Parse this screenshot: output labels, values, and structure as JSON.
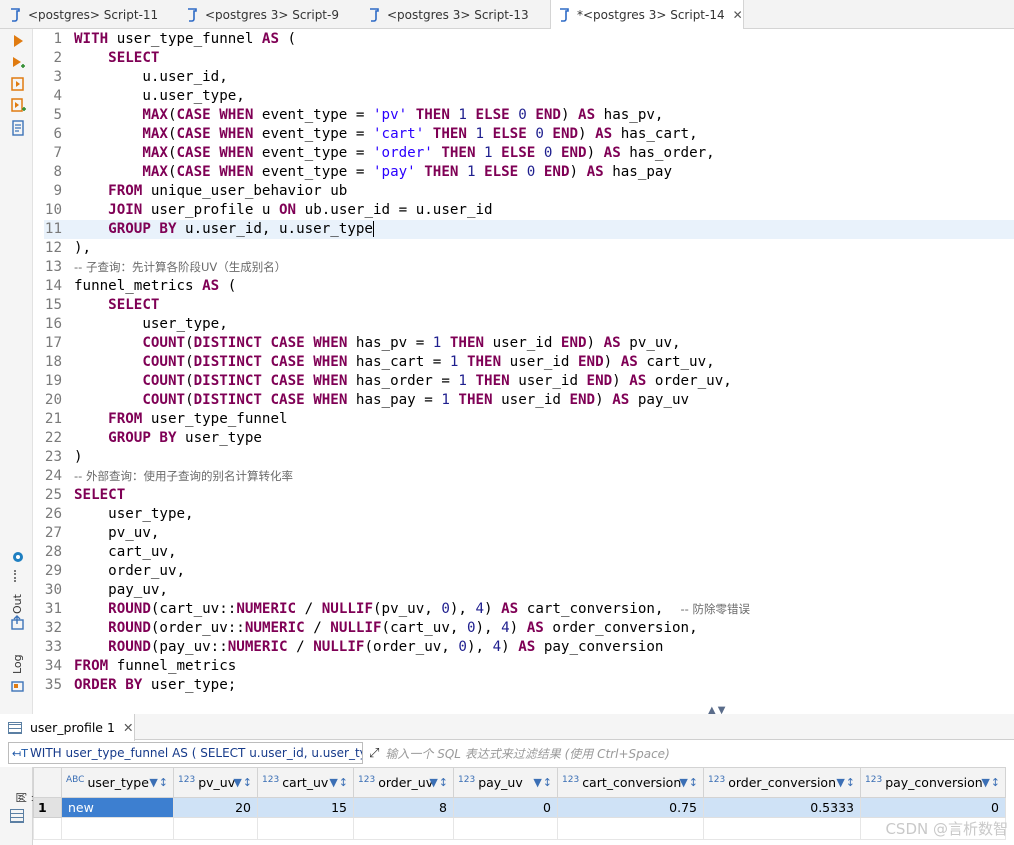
{
  "tabs": [
    {
      "label": "<postgres> Script-11",
      "active": false
    },
    {
      "label": "<postgres 3> Script-9",
      "active": false
    },
    {
      "label": "<postgres 3> Script-13",
      "active": false
    },
    {
      "label": "*<postgres 3> Script-14",
      "active": true
    }
  ],
  "left_toolbar": {
    "out_label": "Out",
    "log_label": "Log"
  },
  "editor": {
    "current_line": 11,
    "lines": [
      {
        "n": 1,
        "tokens": [
          [
            "kw",
            "WITH"
          ],
          [
            "t",
            " user_type_funnel "
          ],
          [
            "kw",
            "AS"
          ],
          [
            "t",
            " ("
          ]
        ]
      },
      {
        "n": 2,
        "tokens": [
          [
            "t",
            "    "
          ],
          [
            "kw",
            "SELECT"
          ]
        ]
      },
      {
        "n": 3,
        "tokens": [
          [
            "t",
            "        u.user_id,"
          ]
        ]
      },
      {
        "n": 4,
        "tokens": [
          [
            "t",
            "        u.user_type,"
          ]
        ]
      },
      {
        "n": 5,
        "tokens": [
          [
            "t",
            "        "
          ],
          [
            "kw",
            "MAX"
          ],
          [
            "t",
            "("
          ],
          [
            "kw",
            "CASE WHEN"
          ],
          [
            "t",
            " event_type = "
          ],
          [
            "str",
            "'pv'"
          ],
          [
            "t",
            " "
          ],
          [
            "kw",
            "THEN"
          ],
          [
            "t",
            " "
          ],
          [
            "num",
            "1"
          ],
          [
            "t",
            " "
          ],
          [
            "kw",
            "ELSE"
          ],
          [
            "t",
            " "
          ],
          [
            "num",
            "0"
          ],
          [
            "t",
            " "
          ],
          [
            "kw",
            "END"
          ],
          [
            "t",
            ") "
          ],
          [
            "kw",
            "AS"
          ],
          [
            "t",
            " has_pv,"
          ]
        ]
      },
      {
        "n": 6,
        "tokens": [
          [
            "t",
            "        "
          ],
          [
            "kw",
            "MAX"
          ],
          [
            "t",
            "("
          ],
          [
            "kw",
            "CASE WHEN"
          ],
          [
            "t",
            " event_type = "
          ],
          [
            "str",
            "'cart'"
          ],
          [
            "t",
            " "
          ],
          [
            "kw",
            "THEN"
          ],
          [
            "t",
            " "
          ],
          [
            "num",
            "1"
          ],
          [
            "t",
            " "
          ],
          [
            "kw",
            "ELSE"
          ],
          [
            "t",
            " "
          ],
          [
            "num",
            "0"
          ],
          [
            "t",
            " "
          ],
          [
            "kw",
            "END"
          ],
          [
            "t",
            ") "
          ],
          [
            "kw",
            "AS"
          ],
          [
            "t",
            " has_cart,"
          ]
        ]
      },
      {
        "n": 7,
        "tokens": [
          [
            "t",
            "        "
          ],
          [
            "kw",
            "MAX"
          ],
          [
            "t",
            "("
          ],
          [
            "kw",
            "CASE WHEN"
          ],
          [
            "t",
            " event_type = "
          ],
          [
            "str",
            "'order'"
          ],
          [
            "t",
            " "
          ],
          [
            "kw",
            "THEN"
          ],
          [
            "t",
            " "
          ],
          [
            "num",
            "1"
          ],
          [
            "t",
            " "
          ],
          [
            "kw",
            "ELSE"
          ],
          [
            "t",
            " "
          ],
          [
            "num",
            "0"
          ],
          [
            "t",
            " "
          ],
          [
            "kw",
            "END"
          ],
          [
            "t",
            ") "
          ],
          [
            "kw",
            "AS"
          ],
          [
            "t",
            " has_order,"
          ]
        ]
      },
      {
        "n": 8,
        "tokens": [
          [
            "t",
            "        "
          ],
          [
            "kw",
            "MAX"
          ],
          [
            "t",
            "("
          ],
          [
            "kw",
            "CASE WHEN"
          ],
          [
            "t",
            " event_type = "
          ],
          [
            "str",
            "'pay'"
          ],
          [
            "t",
            " "
          ],
          [
            "kw",
            "THEN"
          ],
          [
            "t",
            " "
          ],
          [
            "num",
            "1"
          ],
          [
            "t",
            " "
          ],
          [
            "kw",
            "ELSE"
          ],
          [
            "t",
            " "
          ],
          [
            "num",
            "0"
          ],
          [
            "t",
            " "
          ],
          [
            "kw",
            "END"
          ],
          [
            "t",
            ") "
          ],
          [
            "kw",
            "AS"
          ],
          [
            "t",
            " has_pay"
          ]
        ]
      },
      {
        "n": 9,
        "tokens": [
          [
            "t",
            "    "
          ],
          [
            "kw",
            "FROM"
          ],
          [
            "t",
            " unique_user_behavior ub"
          ]
        ]
      },
      {
        "n": 10,
        "tokens": [
          [
            "t",
            "    "
          ],
          [
            "kw",
            "JOIN"
          ],
          [
            "t",
            " user_profile u "
          ],
          [
            "kw",
            "ON"
          ],
          [
            "t",
            " ub.user_id = u.user_id"
          ]
        ]
      },
      {
        "n": 11,
        "tokens": [
          [
            "t",
            "    "
          ],
          [
            "kw",
            "GROUP BY"
          ],
          [
            "t",
            " u.user_id, u.user_type"
          ]
        ]
      },
      {
        "n": 12,
        "tokens": [
          [
            "t",
            "),"
          ]
        ]
      },
      {
        "n": 13,
        "tokens": [
          [
            "cm",
            "-- 子查询：先计算各阶段UV（生成别名）"
          ]
        ]
      },
      {
        "n": 14,
        "tokens": [
          [
            "t",
            "funnel_metrics "
          ],
          [
            "kw",
            "AS"
          ],
          [
            "t",
            " ("
          ]
        ]
      },
      {
        "n": 15,
        "tokens": [
          [
            "t",
            "    "
          ],
          [
            "kw",
            "SELECT"
          ]
        ]
      },
      {
        "n": 16,
        "tokens": [
          [
            "t",
            "        user_type,"
          ]
        ]
      },
      {
        "n": 17,
        "tokens": [
          [
            "t",
            "        "
          ],
          [
            "kw",
            "COUNT"
          ],
          [
            "t",
            "("
          ],
          [
            "kw",
            "DISTINCT CASE WHEN"
          ],
          [
            "t",
            " has_pv = "
          ],
          [
            "num",
            "1"
          ],
          [
            "t",
            " "
          ],
          [
            "kw",
            "THEN"
          ],
          [
            "t",
            " user_id "
          ],
          [
            "kw",
            "END"
          ],
          [
            "t",
            ") "
          ],
          [
            "kw",
            "AS"
          ],
          [
            "t",
            " pv_uv,"
          ]
        ]
      },
      {
        "n": 18,
        "tokens": [
          [
            "t",
            "        "
          ],
          [
            "kw",
            "COUNT"
          ],
          [
            "t",
            "("
          ],
          [
            "kw",
            "DISTINCT CASE WHEN"
          ],
          [
            "t",
            " has_cart = "
          ],
          [
            "num",
            "1"
          ],
          [
            "t",
            " "
          ],
          [
            "kw",
            "THEN"
          ],
          [
            "t",
            " user_id "
          ],
          [
            "kw",
            "END"
          ],
          [
            "t",
            ") "
          ],
          [
            "kw",
            "AS"
          ],
          [
            "t",
            " cart_uv,"
          ]
        ]
      },
      {
        "n": 19,
        "tokens": [
          [
            "t",
            "        "
          ],
          [
            "kw",
            "COUNT"
          ],
          [
            "t",
            "("
          ],
          [
            "kw",
            "DISTINCT CASE WHEN"
          ],
          [
            "t",
            " has_order = "
          ],
          [
            "num",
            "1"
          ],
          [
            "t",
            " "
          ],
          [
            "kw",
            "THEN"
          ],
          [
            "t",
            " user_id "
          ],
          [
            "kw",
            "END"
          ],
          [
            "t",
            ") "
          ],
          [
            "kw",
            "AS"
          ],
          [
            "t",
            " order_uv,"
          ]
        ]
      },
      {
        "n": 20,
        "tokens": [
          [
            "t",
            "        "
          ],
          [
            "kw",
            "COUNT"
          ],
          [
            "t",
            "("
          ],
          [
            "kw",
            "DISTINCT CASE WHEN"
          ],
          [
            "t",
            " has_pay = "
          ],
          [
            "num",
            "1"
          ],
          [
            "t",
            " "
          ],
          [
            "kw",
            "THEN"
          ],
          [
            "t",
            " user_id "
          ],
          [
            "kw",
            "END"
          ],
          [
            "t",
            ") "
          ],
          [
            "kw",
            "AS"
          ],
          [
            "t",
            " pay_uv"
          ]
        ]
      },
      {
        "n": 21,
        "tokens": [
          [
            "t",
            "    "
          ],
          [
            "kw",
            "FROM"
          ],
          [
            "t",
            " user_type_funnel"
          ]
        ]
      },
      {
        "n": 22,
        "tokens": [
          [
            "t",
            "    "
          ],
          [
            "kw",
            "GROUP BY"
          ],
          [
            "t",
            " user_type"
          ]
        ]
      },
      {
        "n": 23,
        "tokens": [
          [
            "t",
            ")"
          ]
        ]
      },
      {
        "n": 24,
        "tokens": [
          [
            "cm",
            "-- 外部查询：使用子查询的别名计算转化率"
          ]
        ]
      },
      {
        "n": 25,
        "tokens": [
          [
            "kw",
            "SELECT"
          ]
        ]
      },
      {
        "n": 26,
        "tokens": [
          [
            "t",
            "    user_type,"
          ]
        ]
      },
      {
        "n": 27,
        "tokens": [
          [
            "t",
            "    pv_uv,"
          ]
        ]
      },
      {
        "n": 28,
        "tokens": [
          [
            "t",
            "    cart_uv,"
          ]
        ]
      },
      {
        "n": 29,
        "tokens": [
          [
            "t",
            "    order_uv,"
          ]
        ]
      },
      {
        "n": 30,
        "tokens": [
          [
            "t",
            "    pay_uv,"
          ]
        ]
      },
      {
        "n": 31,
        "tokens": [
          [
            "t",
            "    "
          ],
          [
            "kw",
            "ROUND"
          ],
          [
            "t",
            "(cart_uv::"
          ],
          [
            "kw",
            "NUMERIC"
          ],
          [
            "t",
            " / "
          ],
          [
            "kw",
            "NULLIF"
          ],
          [
            "t",
            "(pv_uv, "
          ],
          [
            "num",
            "0"
          ],
          [
            "t",
            "), "
          ],
          [
            "num",
            "4"
          ],
          [
            "t",
            ") "
          ],
          [
            "kw",
            "AS"
          ],
          [
            "t",
            " cart_conversion,  "
          ],
          [
            "cm",
            "-- 防除零错误"
          ]
        ]
      },
      {
        "n": 32,
        "tokens": [
          [
            "t",
            "    "
          ],
          [
            "kw",
            "ROUND"
          ],
          [
            "t",
            "(order_uv::"
          ],
          [
            "kw",
            "NUMERIC"
          ],
          [
            "t",
            " / "
          ],
          [
            "kw",
            "NULLIF"
          ],
          [
            "t",
            "(cart_uv, "
          ],
          [
            "num",
            "0"
          ],
          [
            "t",
            "), "
          ],
          [
            "num",
            "4"
          ],
          [
            "t",
            ") "
          ],
          [
            "kw",
            "AS"
          ],
          [
            "t",
            " order_conversion,"
          ]
        ]
      },
      {
        "n": 33,
        "tokens": [
          [
            "t",
            "    "
          ],
          [
            "kw",
            "ROUND"
          ],
          [
            "t",
            "(pay_uv::"
          ],
          [
            "kw",
            "NUMERIC"
          ],
          [
            "t",
            " / "
          ],
          [
            "kw",
            "NULLIF"
          ],
          [
            "t",
            "(order_uv, "
          ],
          [
            "num",
            "0"
          ],
          [
            "t",
            "), "
          ],
          [
            "num",
            "4"
          ],
          [
            "t",
            ") "
          ],
          [
            "kw",
            "AS"
          ],
          [
            "t",
            " pay_conversion"
          ]
        ]
      },
      {
        "n": 34,
        "tokens": [
          [
            "kw",
            "FROM"
          ],
          [
            "t",
            " funnel_metrics"
          ]
        ]
      },
      {
        "n": 35,
        "tokens": [
          [
            "kw",
            "ORDER BY"
          ],
          [
            "t",
            " user_type;"
          ]
        ]
      }
    ]
  },
  "results": {
    "tab_label": "user_profile 1",
    "query_text": "WITH user_type_funnel AS ( SELECT u.user_id, u.user_type",
    "filter_placeholder": "输入一个 SQL 表达式来过滤结果 (使用 Ctrl+Space)",
    "side_label": "网格",
    "columns": [
      {
        "name": "user_type",
        "type": "ABC"
      },
      {
        "name": "pv_uv",
        "type": "123"
      },
      {
        "name": "cart_uv",
        "type": "123"
      },
      {
        "name": "order_uv",
        "type": "123"
      },
      {
        "name": "pay_uv",
        "type": "123"
      },
      {
        "name": "cart_conversion",
        "type": "123"
      },
      {
        "name": "order_conversion",
        "type": "123"
      },
      {
        "name": "pay_conversion",
        "type": "123"
      }
    ],
    "rows": [
      {
        "rownum": "1",
        "cells": [
          "new",
          "20",
          "15",
          "8",
          "0",
          "0.75",
          "0.5333",
          "0"
        ]
      }
    ]
  },
  "watermark": "CSDN @言析数智"
}
